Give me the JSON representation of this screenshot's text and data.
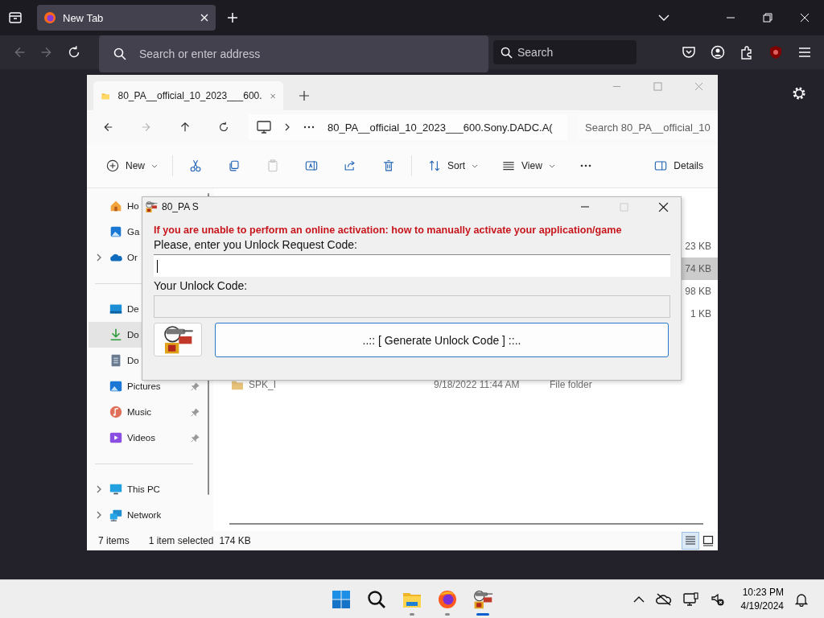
{
  "browser": {
    "tabs": [
      {
        "title": "New Tab",
        "selected": true
      }
    ],
    "nav": [
      {
        "kind": "back",
        "disabled": true
      },
      {
        "kind": "forward",
        "disabled": true
      },
      {
        "kind": "reload",
        "disabled": false
      }
    ],
    "address": {
      "placeholder": "Search or enter address"
    },
    "search": {
      "placeholder": "Search"
    }
  },
  "explorer": {
    "tabs": [
      {
        "title": "80_PA__official_10_2023___600.",
        "selected": true
      }
    ],
    "nav": [
      {
        "kind": "back",
        "disabled": false
      },
      {
        "kind": "forward",
        "disabled": true
      },
      {
        "kind": "up",
        "disabled": false
      },
      {
        "kind": "refresh",
        "disabled": false
      }
    ],
    "path": "80_PA__official_10_2023___600.Sony.DADC.A(",
    "search": {
      "placeholder": "Search 80_PA__official_10"
    },
    "commands": [
      {
        "kind": "new",
        "label": "New",
        "disabled": false
      },
      {
        "kind": "cut",
        "disabled": false
      },
      {
        "kind": "copy",
        "disabled": false
      },
      {
        "kind": "paste",
        "disabled": true
      },
      {
        "kind": "rename",
        "disabled": false
      },
      {
        "kind": "share",
        "disabled": false
      },
      {
        "kind": "delete",
        "disabled": false
      },
      {
        "kind": "sort",
        "label": "Sort",
        "disabled": false
      },
      {
        "kind": "view",
        "label": "View",
        "disabled": false
      },
      {
        "kind": "more",
        "disabled": false
      },
      {
        "kind": "details",
        "label": "Details",
        "disabled": false
      }
    ],
    "sidebar": [
      {
        "kind": "home",
        "label": "Ho",
        "selected": false,
        "expandable": false,
        "pinned": false
      },
      {
        "kind": "gallery",
        "label": "Ga",
        "selected": false,
        "expandable": false,
        "pinned": false
      },
      {
        "kind": "cloud",
        "label": "Or",
        "selected": false,
        "expandable": true,
        "pinned": false
      },
      {
        "kind": "divider"
      },
      {
        "kind": "desktop",
        "label": "De",
        "selected": false,
        "expandable": false,
        "pinned": false
      },
      {
        "kind": "downloads",
        "label": "Do",
        "selected": true,
        "expandable": false,
        "pinned": false
      },
      {
        "kind": "documents",
        "label": "Do",
        "selected": false,
        "expandable": false,
        "pinned": false
      },
      {
        "kind": "pictures",
        "label": "Pictures",
        "selected": false,
        "expandable": false,
        "pinned": true
      },
      {
        "kind": "music",
        "label": "Music",
        "selected": false,
        "expandable": false,
        "pinned": true
      },
      {
        "kind": "videos",
        "label": "Videos",
        "selected": false,
        "expandable": false,
        "pinned": true
      },
      {
        "kind": "divider"
      },
      {
        "kind": "pc",
        "label": "This PC",
        "selected": false,
        "expandable": true,
        "pinned": false
      },
      {
        "kind": "network",
        "label": "Network",
        "selected": false,
        "expandable": true,
        "pinned": false
      }
    ],
    "file_rows": [
      {
        "size": "23 KB",
        "selected": false
      },
      {
        "size": "74 KB",
        "selected": true
      },
      {
        "size": "98 KB",
        "selected": false
      },
      {
        "size": "1 KB",
        "selected": false
      }
    ],
    "folder_rows": [
      {
        "name": "SPK_I",
        "date": "9/18/2022 11:44 AM",
        "type": "File folder",
        "selected": false
      }
    ],
    "status": {
      "items": "7 items",
      "selection": "1 item selected",
      "size": "174 KB"
    },
    "views": [
      {
        "kind": "details",
        "selected": true
      },
      {
        "kind": "tiles",
        "selected": false
      }
    ]
  },
  "dialog": {
    "title": "80_PA S",
    "maximize_disabled": true,
    "notice": "If you are unable to perform an online activation: how to manually activate your application/game",
    "request_label": "Please, enter you Unlock Request Code:",
    "request_field": {
      "focused": true,
      "readonly": false
    },
    "unlock_label": "Your Unlock Code:",
    "unlock_field": {
      "focused": false,
      "readonly": true
    },
    "button": "..:: [ Generate Unlock Code ] ::.."
  },
  "taskbar": {
    "apps": [
      {
        "kind": "start",
        "running": false
      },
      {
        "kind": "search",
        "running": false
      },
      {
        "kind": "explorer",
        "running": true,
        "active": false
      },
      {
        "kind": "firefox",
        "running": true,
        "active": false
      },
      {
        "kind": "keygen",
        "running": true,
        "active": true
      }
    ],
    "time": "10:23 PM",
    "date": "4/19/2024"
  }
}
